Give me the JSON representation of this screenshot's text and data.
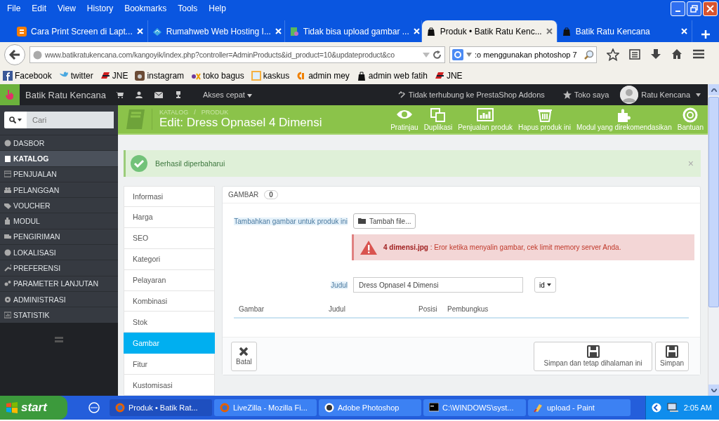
{
  "menu": [
    "File",
    "Edit",
    "View",
    "History",
    "Bookmarks",
    "Tools",
    "Help"
  ],
  "browser_tabs": [
    {
      "title": "Cara Print Screen di Lapt...",
      "selected": false
    },
    {
      "title": "Rumahweb Web Hosting I...",
      "selected": false
    },
    {
      "title": "Tidak bisa upload gambar ...",
      "selected": false
    },
    {
      "title": "Produk • Batik Ratu Kenc...",
      "selected": true
    },
    {
      "title": "Batik Ratu Kencana",
      "selected": false
    }
  ],
  "address": {
    "url": "www.batikratukencana.com/kangoyik/index.php?controller=AdminProducts&id_product=10&updateproduct&co"
  },
  "search": {
    "value": ":o menggunakan photoshop 7"
  },
  "bookmarks": [
    "Facebook",
    "twitter",
    "JNE",
    "instagram",
    "toko bagus",
    "kaskus",
    "admin mey",
    "admin web fatih",
    "JNE"
  ],
  "admin_bar": {
    "shop_name": "Batik Ratu Kencana",
    "quick_access": "Akses cepat",
    "addons_status": "Tidak terhubung ke PrestaShop Addons",
    "my_shop": "Toko saya",
    "user": "Ratu Kencana"
  },
  "sidebar": {
    "search_placeholder": "Cari",
    "items": [
      {
        "label": "DASBOR",
        "selected": false
      },
      {
        "label": "KATALOG",
        "selected": true
      },
      {
        "label": "PENJUALAN",
        "selected": false
      },
      {
        "label": "PELANGGAN",
        "selected": false
      },
      {
        "label": "VOUCHER",
        "selected": false
      },
      {
        "label": "MODUL",
        "selected": false
      },
      {
        "label": "PENGIRIMAN",
        "selected": false
      },
      {
        "label": "LOKALISASI",
        "selected": false
      },
      {
        "label": "PREFERENSI",
        "selected": false
      },
      {
        "label": "PARAMETER LANJUTAN",
        "selected": false
      },
      {
        "label": "ADMINISTRASI",
        "selected": false
      },
      {
        "label": "STATISTIK",
        "selected": false
      }
    ]
  },
  "toolbar": {
    "breadcrumb": [
      "KATALOG",
      "PRODUK"
    ],
    "breadcrumb_separator": "/",
    "title": "Edit: Dress Opnasel 4 Dimensi",
    "actions": [
      "Pratinjau",
      "Duplikasi",
      "Penjualan produk",
      "Hapus produk ini",
      "Modul yang direkomendasikan",
      "Bantuan"
    ]
  },
  "alert": {
    "message": "Berhasil diperbaharui",
    "close": "×"
  },
  "product_tabs": [
    {
      "label": "Informasi",
      "selected": false
    },
    {
      "label": "Harga",
      "selected": false
    },
    {
      "label": "SEO",
      "selected": false
    },
    {
      "label": "Kategori",
      "selected": false
    },
    {
      "label": "Pelayaran",
      "selected": false
    },
    {
      "label": "Kombinasi",
      "selected": false
    },
    {
      "label": "Stok",
      "selected": false
    },
    {
      "label": "Gambar",
      "selected": true
    },
    {
      "label": "Fitur",
      "selected": false
    },
    {
      "label": "Kustomisasi",
      "selected": false
    }
  ],
  "panel": {
    "heading": "GAMBAR",
    "count": "0",
    "add_label": "Tambahkan gambar untuk produk ini",
    "add_button": "Tambah file...",
    "error": "**4 dimensi.jpg** : Eror ketika menyalin gambar, cek limit memory server Anda.",
    "title_label": "Judul",
    "title_value": "Dress Opnasel 4 Dimensi",
    "language": "id",
    "columns": [
      "Gambar",
      "Judul",
      "Posisi",
      "Pembungkus"
    ],
    "cancel": "Batal",
    "save_stay": "Simpan dan tetap dihalaman ini",
    "save": "Simpan"
  },
  "taskbar": {
    "start": "start",
    "items": [
      {
        "label": "Produk • Batik Rat...",
        "selected": true
      },
      {
        "label": "LiveZilla - Mozilla Fi...",
        "selected": false
      },
      {
        "label": "Adobe Photoshop",
        "selected": false
      },
      {
        "label": "C:\\WINDOWS\\syst...",
        "selected": false
      },
      {
        "label": "upload - Paint",
        "selected": false
      }
    ],
    "clock": "2:05 AM"
  }
}
